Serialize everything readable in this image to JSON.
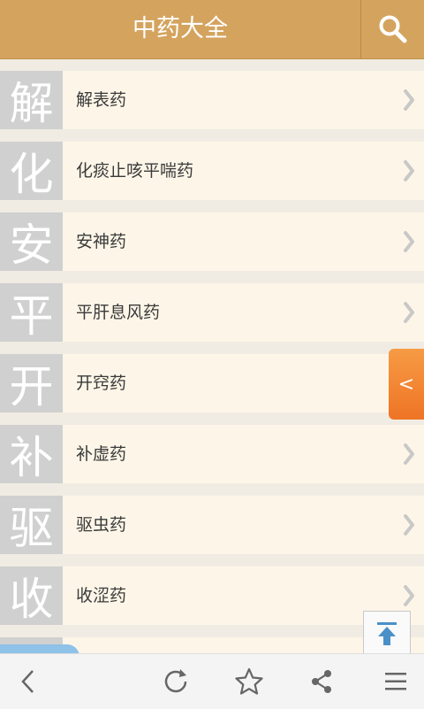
{
  "header": {
    "title": "中药大全",
    "search_icon": "search-icon"
  },
  "categories": [
    {
      "char": "解",
      "label": "解表药"
    },
    {
      "char": "化",
      "label": "化痰止咳平喘药"
    },
    {
      "char": "安",
      "label": "安神药"
    },
    {
      "char": "平",
      "label": "平肝息风药"
    },
    {
      "char": "开",
      "label": "开窍药"
    },
    {
      "char": "补",
      "label": "补虚药"
    },
    {
      "char": "驱",
      "label": "驱虫药"
    },
    {
      "char": "收",
      "label": "收涩药"
    }
  ],
  "side_tab": {
    "label": "<"
  },
  "toolbar": {
    "icons": [
      "back-icon",
      "refresh-icon",
      "star-icon",
      "share-icon",
      "menu-icon"
    ]
  },
  "colors": {
    "header": "#d4a45f",
    "item_background": "#fdf6e8",
    "char_tile": "#d0d0d0",
    "side_tab": "#f08030"
  }
}
